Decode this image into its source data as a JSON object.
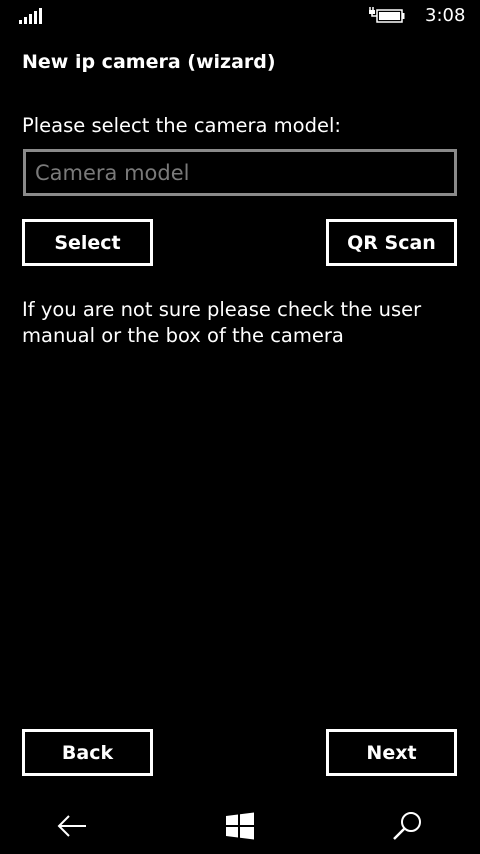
{
  "status_bar": {
    "time": "3:08",
    "signal_icon": "signal-bars-icon",
    "battery_icon": "battery-charging-icon"
  },
  "page": {
    "title": "New ip camera (wizard)",
    "prompt": "Please select the camera model:",
    "input_placeholder": "Camera model",
    "input_value": "",
    "hint": "If you are not sure please check the user manual or the box of the camera"
  },
  "buttons": {
    "select": "Select",
    "qr_scan": "QR Scan",
    "back": "Back",
    "next": "Next"
  },
  "nav_bar": {
    "back_icon": "back-arrow-icon",
    "start_icon": "windows-logo-icon",
    "search_icon": "search-icon"
  },
  "colors": {
    "background": "#000000",
    "foreground": "#ffffff",
    "input_border": "#8a8a8a",
    "placeholder": "#7a7a7a"
  }
}
